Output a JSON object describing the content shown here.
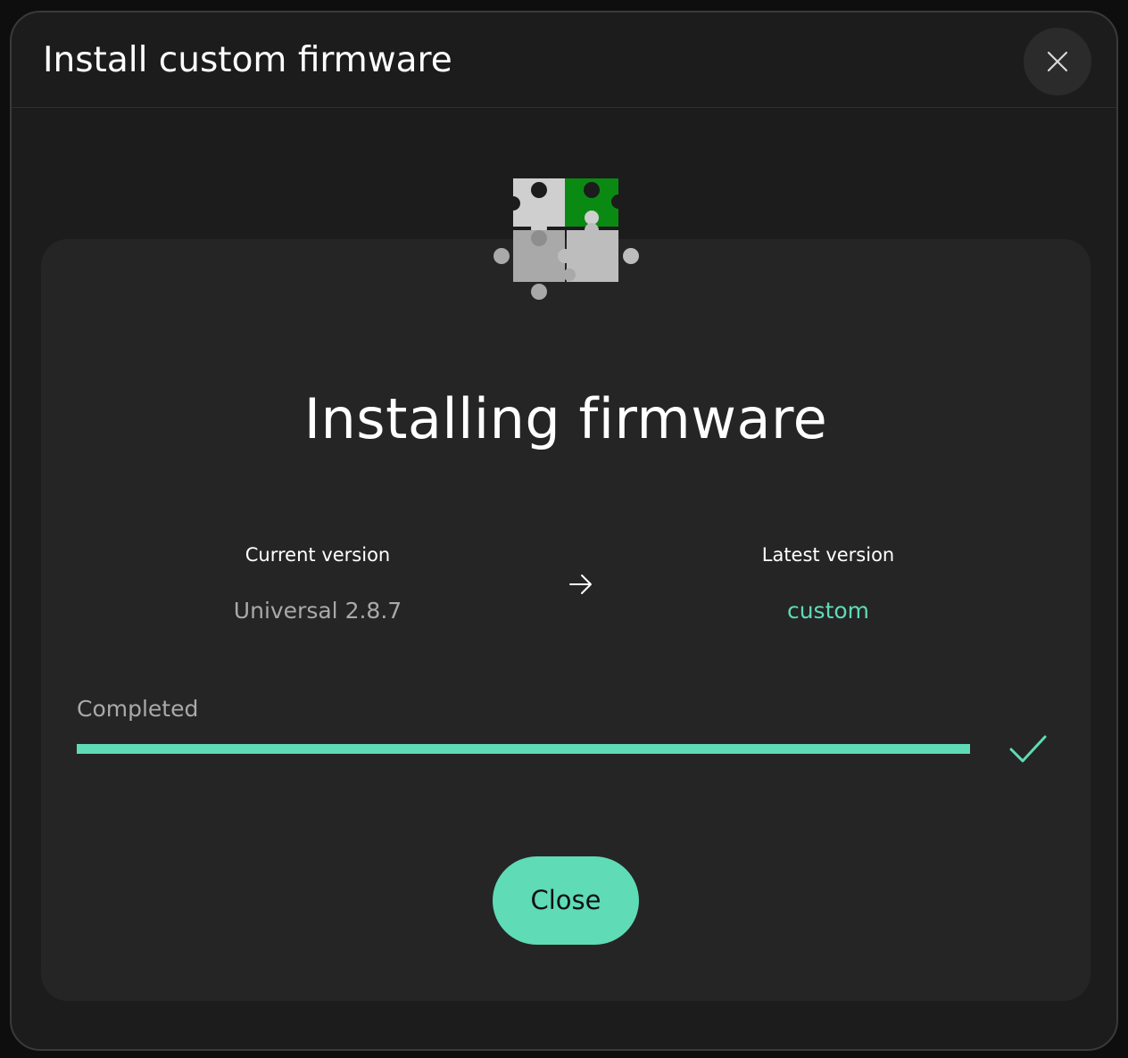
{
  "modal": {
    "title": "Install custom firmware",
    "close_icon": "close-icon"
  },
  "hero": {
    "icon": "puzzle-pieces-icon",
    "title": "Installing firmware"
  },
  "versions": {
    "current_label": "Current version",
    "current_value": "Universal 2.8.7",
    "arrow_icon": "arrow-right-icon",
    "latest_label": "Latest version",
    "latest_value": "custom"
  },
  "progress": {
    "label": "Completed",
    "percent": 100,
    "status_icon": "checkmark-icon"
  },
  "actions": {
    "close_label": "Close"
  },
  "colors": {
    "accent": "#5fdbb6",
    "modal_background": "#1c1c1c",
    "card_background": "#252525",
    "puzzle_green": "#0b8a13",
    "puzzle_gray": "#bdbdbd"
  }
}
